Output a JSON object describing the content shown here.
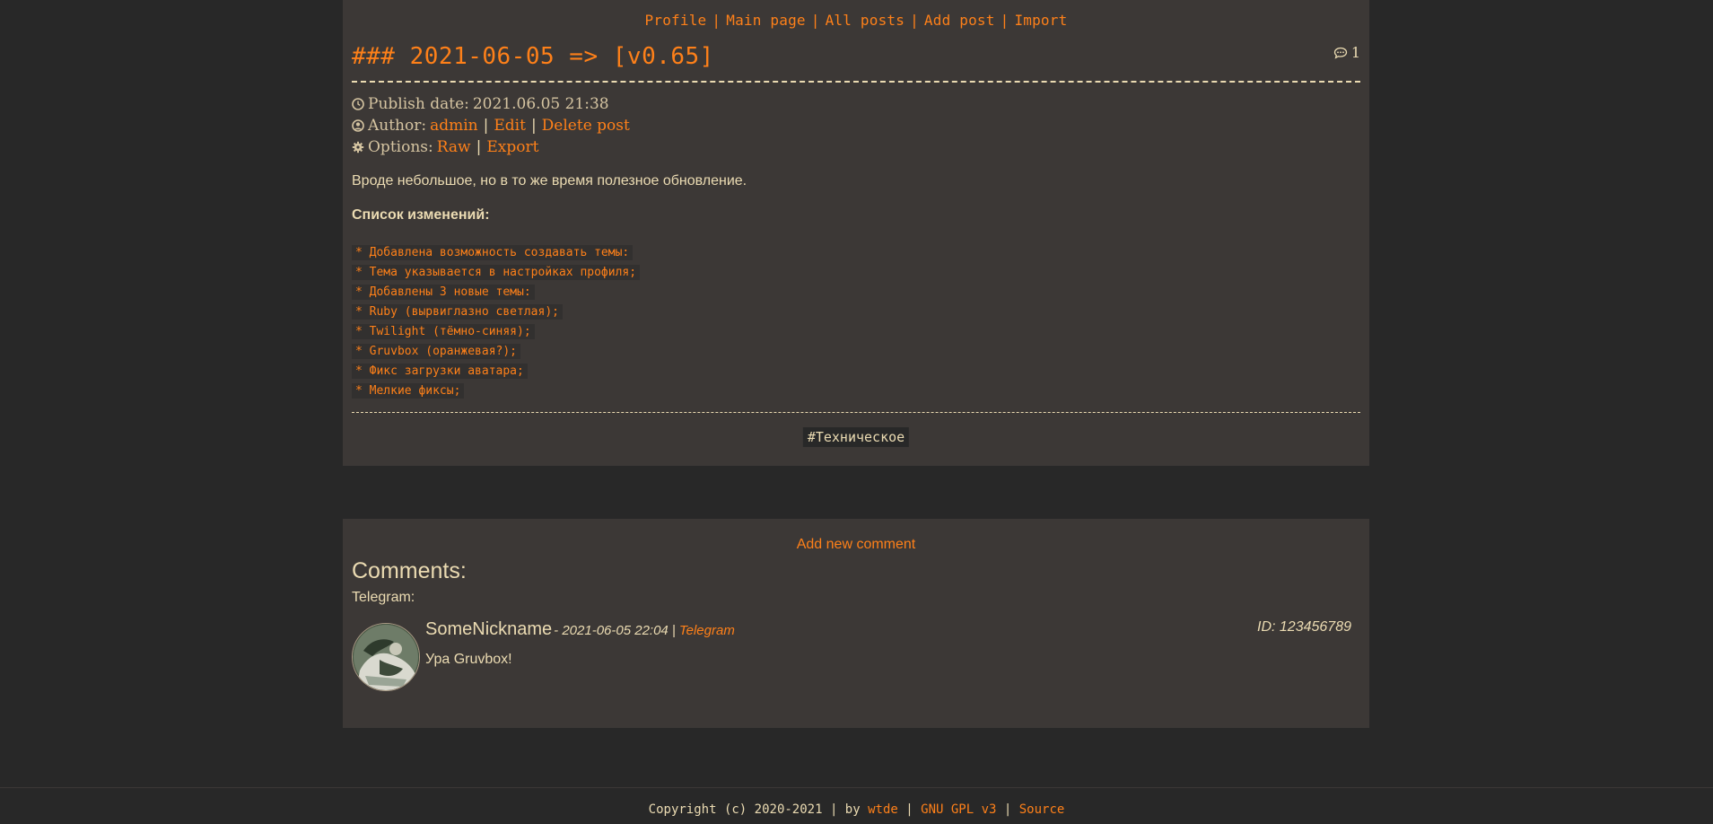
{
  "nav": {
    "profile": "Profile",
    "main_page": "Main page",
    "all_posts": "All posts",
    "add_post": "Add post",
    "import": "Import",
    "separator": "|"
  },
  "post": {
    "title": "### 2021-06-05 => [v0.65]",
    "comment_count": "1",
    "publish_label": "Publish date:",
    "publish_date": "2021.06.05 21:38",
    "author_label": "Author:",
    "author_name": "admin",
    "edit_label": "Edit",
    "delete_label": "Delete post",
    "options_label": "Options:",
    "raw_label": "Raw",
    "export_label": "Export",
    "intro": "Вроде небольшое, но в то же время полезное обновление.",
    "changes_heading": "Список изменений:",
    "changes": [
      "* Добавлена возможность создавать темы:",
      "* Тема указывается в настройках профиля;",
      "* Добавлены 3 новые темы:",
      "* Ruby (вырвиглазно светлая);",
      "* Twilight (тёмно-синяя);",
      "* Gruvbox (оранжевая?);",
      "* Фикс загрузки аватара;",
      "* Мелкие фиксы;"
    ],
    "tag": "#Техническое"
  },
  "comments": {
    "add_label": "Add new comment",
    "heading": "Comments:",
    "source_group": "Telegram:",
    "items": [
      {
        "author": "SomeNickname",
        "date": "- 2021-06-05 22:04 |",
        "source": "Telegram",
        "id": "ID: 123456789",
        "text": "Ура Gruvbox!"
      }
    ]
  },
  "footer": {
    "copyright": "Copyright (c) 2020-2021 | by",
    "author": "wtde",
    "license": "GNU GPL v3",
    "source": "Source",
    "separator": "|"
  },
  "colors": {
    "background": "#282828",
    "card": "#3c3836",
    "accent": "#fe8019",
    "text": "#ebdbb2"
  },
  "icons": {
    "comments": "comment-bubble-icon",
    "date": "clock-icon",
    "author": "user-circle-icon",
    "options": "gear-icon"
  }
}
